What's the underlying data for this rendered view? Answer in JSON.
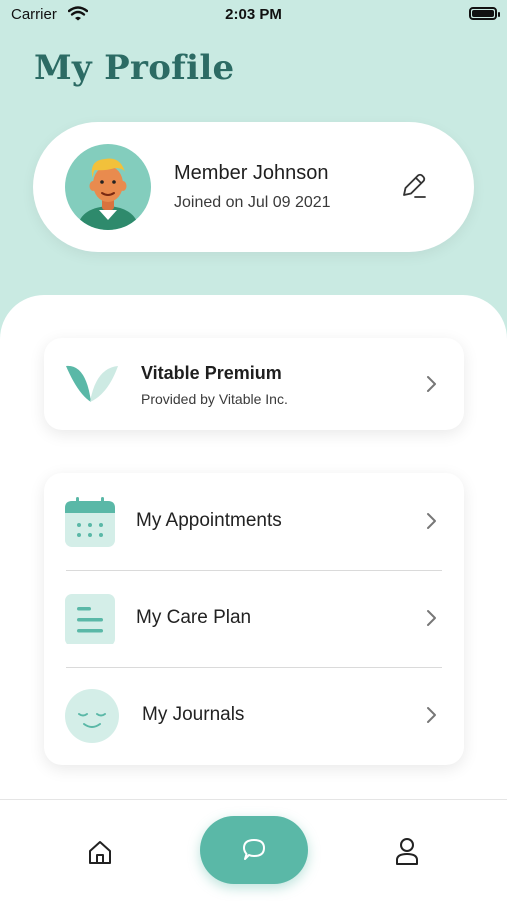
{
  "status_bar": {
    "carrier": "Carrier",
    "time": "2:03 PM"
  },
  "header": {
    "title": "My Profile"
  },
  "profile": {
    "name": "Member Johnson",
    "joined": "Joined on Jul 09 2021"
  },
  "plan": {
    "name": "Vitable Premium",
    "provider": "Provided by Vitable Inc."
  },
  "menu": [
    {
      "label": "My Appointments",
      "icon": "calendar-icon"
    },
    {
      "label": "My Care Plan",
      "icon": "document-icon"
    },
    {
      "label": "My Journals",
      "icon": "smiley-face-icon"
    }
  ],
  "nav": [
    "home-icon",
    "chat-icon",
    "profile-icon"
  ],
  "colors": {
    "background": "#c9eae2",
    "title": "#2c6b64",
    "accent": "#5ab8a7",
    "icon_bg": "#d4eee8"
  }
}
